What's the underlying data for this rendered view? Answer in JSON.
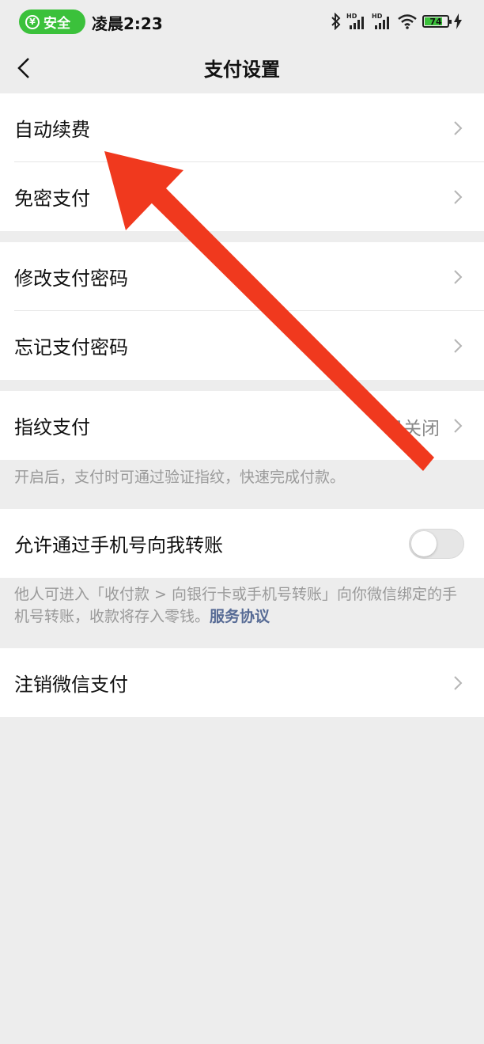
{
  "status_bar": {
    "safe_label": "安全",
    "time": "凌晨2:23",
    "battery": "74",
    "icons": [
      "bluetooth-icon",
      "signal-hd-icon",
      "signal-hd-icon",
      "wifi-icon",
      "battery-icon",
      "charging-icon"
    ]
  },
  "nav": {
    "title": "支付设置"
  },
  "groups": [
    {
      "items": [
        {
          "label": "自动续费"
        },
        {
          "label": "免密支付"
        }
      ]
    },
    {
      "items": [
        {
          "label": "修改支付密码"
        },
        {
          "label": "忘记支付密码"
        }
      ]
    },
    {
      "items": [
        {
          "label": "指纹支付",
          "value": "已关闭"
        }
      ]
    },
    {
      "items": [
        {
          "label": "允许通过手机号向我转账",
          "toggle": false
        }
      ]
    },
    {
      "items": [
        {
          "label": "注销微信支付"
        }
      ]
    }
  ],
  "notes": {
    "fingerprint": "开启后，支付时可通过验证指纹，快速完成付款。",
    "transfer": "他人可进入「收付款 > 向银行卡或手机号转账」向你微信绑定的手机号转账，收款将存入零钱。",
    "transfer_link": "服务协议"
  },
  "colors": {
    "background": "#ededed",
    "link": "#576b95",
    "safe_green": "#3bc13b",
    "annotation_arrow": "#f0391e"
  }
}
